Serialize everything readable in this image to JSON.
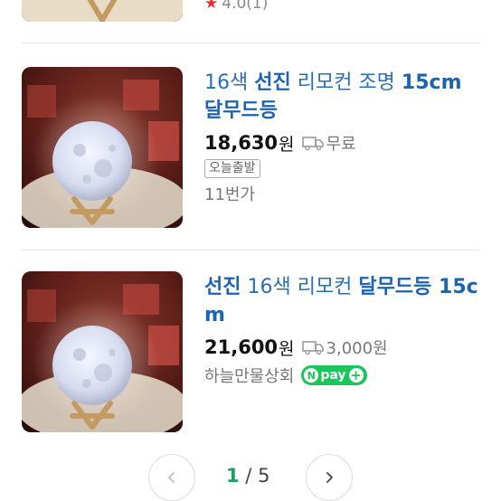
{
  "partial_item": {
    "rating_star": "★",
    "rating": "4.0(1)"
  },
  "items": [
    {
      "title_parts": [
        "16색 ",
        "선진",
        " 리모컨 조명 ",
        "15cm 달무드등"
      ],
      "price": "18,630",
      "currency": "원",
      "shipping_icon": "truck-icon",
      "shipping": "무료",
      "badge": "오늘출발",
      "seller": "11번가"
    },
    {
      "title_parts": [
        "선진",
        " 16색 리모컨 ",
        "달무드등 15cm"
      ],
      "price": "21,600",
      "currency": "원",
      "shipping_icon": "truck-icon",
      "shipping": "3,000원",
      "seller": "하늘만물상회",
      "npay_label": "pay"
    }
  ],
  "pagination": {
    "current": "1",
    "separator": " / ",
    "total": "5"
  },
  "colors": {
    "title_blue": "#1c64b1",
    "star_red": "#e8312f",
    "npay_green": "#19c75a",
    "page_green": "#1aa05a"
  }
}
